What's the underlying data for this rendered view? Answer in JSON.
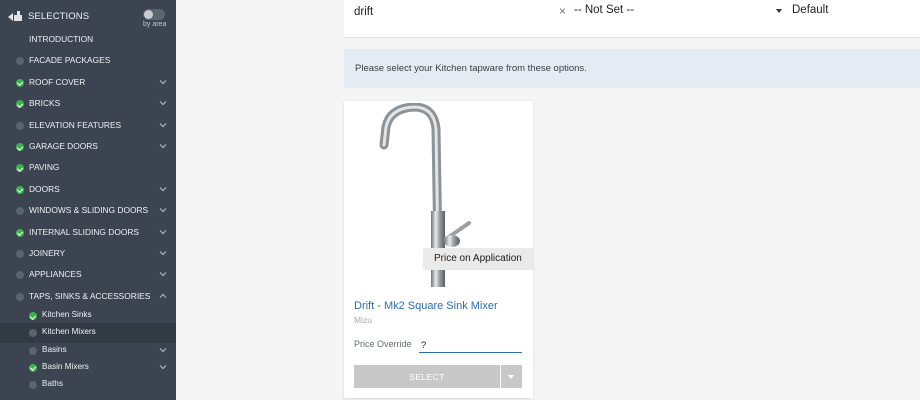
{
  "sidebar": {
    "title": "SELECTIONS",
    "toggle_label": "by area",
    "items": [
      {
        "label": "INTRODUCTION",
        "status": "none",
        "chevron": "none"
      },
      {
        "label": "FACADE PACKAGES",
        "status": "grey",
        "chevron": "none"
      },
      {
        "label": "ROOF COVER",
        "status": "green",
        "chevron": "down"
      },
      {
        "label": "BRICKS",
        "status": "green",
        "chevron": "down"
      },
      {
        "label": "ELEVATION FEATURES",
        "status": "grey",
        "chevron": "down"
      },
      {
        "label": "GARAGE DOORS",
        "status": "green",
        "chevron": "down"
      },
      {
        "label": "PAVING",
        "status": "green",
        "chevron": "none"
      },
      {
        "label": "DOORS",
        "status": "green",
        "chevron": "down"
      },
      {
        "label": "WINDOWS & SLIDING DOORS",
        "status": "grey",
        "chevron": "down"
      },
      {
        "label": "INTERNAL SLIDING DOORS",
        "status": "green",
        "chevron": "down"
      },
      {
        "label": "JOINERY",
        "status": "grey",
        "chevron": "down"
      },
      {
        "label": "APPLIANCES",
        "status": "grey",
        "chevron": "down"
      },
      {
        "label": "TAPS, SINKS & ACCESSORIES",
        "status": "grey",
        "chevron": "up"
      }
    ],
    "sub_items": [
      {
        "label": "Kitchen Sinks",
        "status": "green",
        "chevron": "none",
        "active": false
      },
      {
        "label": "Kitchen Mixers",
        "status": "grey",
        "chevron": "none",
        "active": true
      },
      {
        "label": "Basins",
        "status": "grey",
        "chevron": "down",
        "active": false
      },
      {
        "label": "Basin Mixers",
        "status": "green",
        "chevron": "down",
        "active": false
      },
      {
        "label": "Baths",
        "status": "grey",
        "chevron": "none",
        "active": false
      }
    ]
  },
  "filters": {
    "search_value": "drift",
    "clear_symbol": "×",
    "category_select": "-- Not Set --",
    "sort_select": "Default"
  },
  "info": {
    "message": "Please select your Kitchen tapware from these options."
  },
  "product": {
    "price_label": "Price on Application",
    "name": "Drift - Mk2 Square Sink Mixer",
    "brand": "Mizu",
    "override_label": "Price Override",
    "override_value": "?",
    "select_label": "SELECT"
  },
  "colors": {
    "sidebar_bg": "#3b4450",
    "check_green": "#39b54a",
    "link_blue": "#2b6eb0",
    "banner_bg": "#e4ebf3"
  }
}
